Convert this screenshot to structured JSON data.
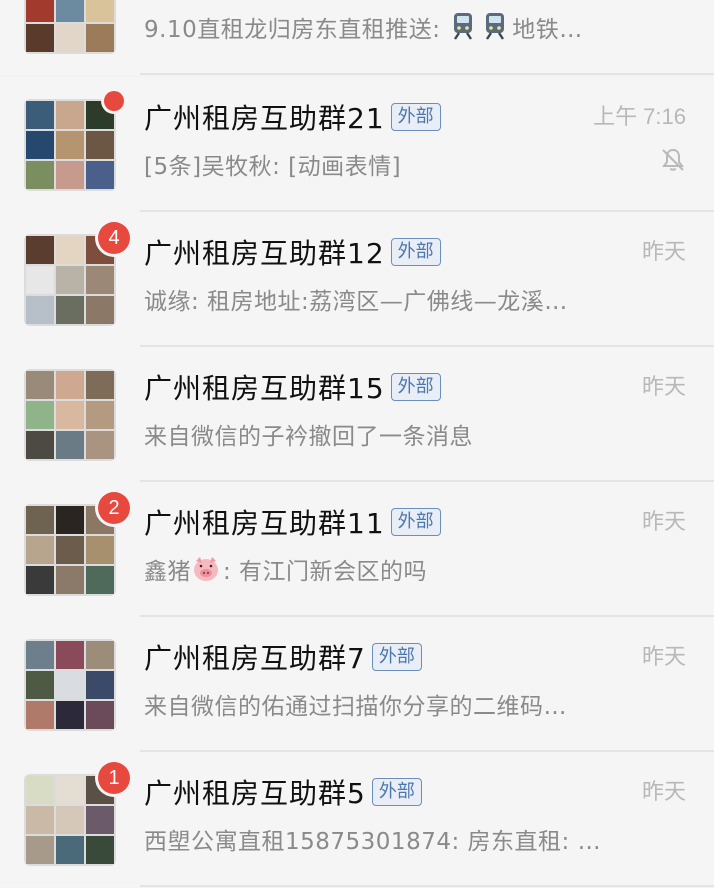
{
  "chats": [
    {
      "name": "",
      "tag": "",
      "preview_prefix": "9.10直租龙归房东直租推送: ",
      "preview_suffix": "地铁…",
      "preview_emoji": [
        "metro-icon",
        "metro-icon"
      ],
      "time": "",
      "unread": "",
      "has_dot": false,
      "muted": false,
      "avatar_colors": [
        "#8a4b3a",
        "#c7b7a6",
        "#3e4a5a",
        "#a33a2e",
        "#6c8aa0",
        "#d9c39a",
        "#5a3a2a",
        "#e1d6c8",
        "#9b7b5a"
      ]
    },
    {
      "name": "广州租房互助群21",
      "tag": "外部",
      "preview_prefix": "[5条]吴牧秋: [动画表情]",
      "preview_suffix": "",
      "time": "上午 7:16",
      "unread": "",
      "has_dot": true,
      "muted": true,
      "avatar_colors": [
        "#3b5d7a",
        "#c9a78f",
        "#2d3b2a",
        "#27486e",
        "#b5956f",
        "#6b5744",
        "#7a8e5f",
        "#c69b8e",
        "#4a5f8a"
      ]
    },
    {
      "name": "广州租房互助群12",
      "tag": "外部",
      "preview_prefix": "诚缘: 租房地址:荔湾区—广佛线—龙溪…",
      "preview_suffix": "",
      "time": "昨天",
      "unread": "4",
      "has_dot": false,
      "muted": false,
      "avatar_colors": [
        "#5a3d2e",
        "#e4d4c2",
        "#7d4e3c",
        "#e7e7e7",
        "#b8b2a7",
        "#9b8877",
        "#b7c0c8",
        "#6a6e60",
        "#8b7866"
      ]
    },
    {
      "name": "广州租房互助群15",
      "tag": "外部",
      "preview_prefix": "来自微信的子衿撤回了一条消息",
      "preview_suffix": "",
      "time": "昨天",
      "unread": "",
      "has_dot": false,
      "muted": false,
      "avatar_colors": [
        "#9a8a7a",
        "#cfa892",
        "#7e6b58",
        "#8fb48a",
        "#d8b9a0",
        "#b59a82",
        "#4d4a44",
        "#6b7b86",
        "#a89480"
      ]
    },
    {
      "name": "广州租房互助群11",
      "tag": "外部",
      "preview_prefix": "鑫猪",
      "preview_suffix": ": 有江门新会区的吗",
      "preview_emoji": [
        "pig-icon"
      ],
      "time": "昨天",
      "unread": "2",
      "has_dot": false,
      "muted": false,
      "avatar_colors": [
        "#6e6250",
        "#2b2521",
        "#8a7764",
        "#b8a58e",
        "#6c5c4c",
        "#a6906e",
        "#3a3a3a",
        "#8b7a6a",
        "#4f6a5a"
      ]
    },
    {
      "name": "广州租房互助群7",
      "tag": "外部",
      "preview_prefix": "来自微信的佑通过扫描你分享的二维码…",
      "preview_suffix": "",
      "time": "昨天",
      "unread": "",
      "has_dot": false,
      "muted": false,
      "avatar_colors": [
        "#6d7f8c",
        "#8a4a5a",
        "#9b8d7a",
        "#4e5a44",
        "#d9dce0",
        "#3c4a6a",
        "#b07a6a",
        "#2c2a3a",
        "#6b4a5a"
      ]
    },
    {
      "name": "广州租房互助群5",
      "tag": "外部",
      "preview_prefix": "西塱公寓直租15875301874: 房东直租: …",
      "preview_suffix": "",
      "time": "昨天",
      "unread": "1",
      "has_dot": false,
      "muted": false,
      "avatar_colors": [
        "#d9dcc4",
        "#e3ddd2",
        "#5a5046",
        "#c9b9a6",
        "#d5c8b8",
        "#6a5a6a",
        "#a89a8a",
        "#4a6a7a",
        "#3a4a3a"
      ]
    }
  ]
}
